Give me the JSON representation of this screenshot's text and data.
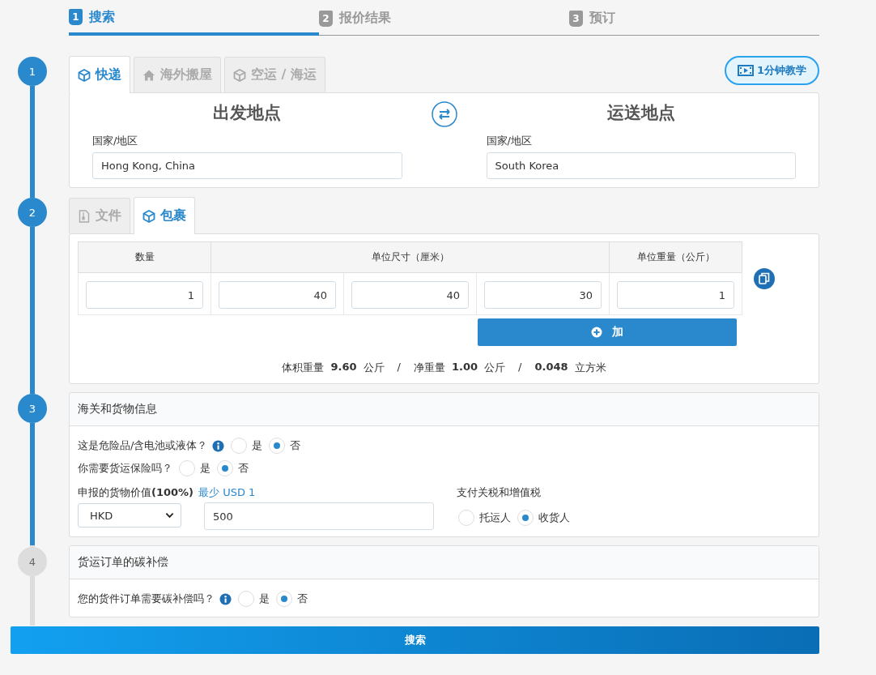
{
  "progress_steps": [
    {
      "number": "1",
      "label": "搜索",
      "selected": true
    },
    {
      "number": "2",
      "label": "报价结果",
      "selected": false
    },
    {
      "number": "3",
      "label": "预订",
      "selected": false
    }
  ],
  "sections": [
    {
      "number": "1",
      "active": true,
      "mode_tabs": [
        {
          "label": "快递",
          "selected": true,
          "kind": "box"
        },
        {
          "label": "海外搬屋",
          "selected": false,
          "kind": "house"
        },
        {
          "label": "空运 / 海运",
          "selected": false,
          "kind": "box"
        }
      ],
      "tutorial_button": "1分钟教学",
      "origin": {
        "heading": "出发地点",
        "field_label": "国家/地区",
        "value": "Hong Kong, China"
      },
      "destination": {
        "heading": "运送地点",
        "field_label": "国家/地区",
        "value": "South Korea"
      }
    },
    {
      "number": "2",
      "active": true,
      "type_tabs": [
        {
          "label": "文件",
          "selected": false,
          "kind": "document"
        },
        {
          "label": "包裹",
          "selected": true,
          "kind": "box"
        }
      ],
      "table": {
        "columns": [
          {
            "label": "数量"
          },
          {
            "label": "单位尺寸（厘米）",
            "colspan": 3
          },
          {
            "label": "单位重量（公斤）"
          }
        ],
        "rows": [
          [
            "1",
            "40",
            "40",
            "30",
            "1"
          ]
        ]
      },
      "add_button": "加",
      "summary": {
        "separator": "/",
        "items": [
          {
            "label": "体积重量",
            "value": "9.60",
            "unit": "公斤"
          },
          {
            "label": "净重量",
            "value": "1.00",
            "unit": "公斤"
          },
          {
            "value": "0.048",
            "unit": "立方米"
          }
        ]
      }
    },
    {
      "number": "3",
      "active": true,
      "title": "海关和货物信息",
      "questions": [
        {
          "label": "这是危险品/含电池或液体？",
          "info": true,
          "options": [
            {
              "label": "是",
              "selected": false
            },
            {
              "label": "否",
              "selected": true
            }
          ]
        },
        {
          "label": "你需要货运保险吗？",
          "info": false,
          "options": [
            {
              "label": "是",
              "selected": false
            },
            {
              "label": "否",
              "selected": true
            }
          ]
        }
      ],
      "declared_value": {
        "label": "申报的货物价值**(100%)**",
        "hint": "最少 USD 1",
        "currency": "HKD",
        "amount": "500"
      },
      "duties": {
        "label": "支付关税和增值税",
        "options": [
          {
            "label": "托运人",
            "selected": false
          },
          {
            "label": "收货人",
            "selected": true
          }
        ]
      }
    },
    {
      "number": "4",
      "active": false,
      "title": "货运订单的碳补偿",
      "questions": [
        {
          "label": "您的货件订单需要碳补偿吗？",
          "info": true,
          "options": [
            {
              "label": "是",
              "selected": false
            },
            {
              "label": "否",
              "selected": true
            }
          ]
        }
      ]
    }
  ],
  "search_button": "搜索"
}
